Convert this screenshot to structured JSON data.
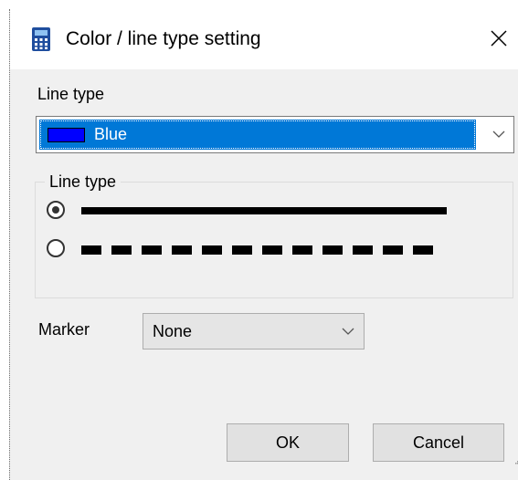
{
  "window": {
    "title": "Color / line type setting",
    "app_icon": "calculator-icon",
    "close_icon": "close-icon"
  },
  "color": {
    "label": "Line type",
    "selected_value": "Blue",
    "swatch_color": "#0000ff",
    "highlight_color": "#0078d7",
    "arrow_icon": "chevron-down-icon"
  },
  "line_type": {
    "group_label": "Line type",
    "options": [
      {
        "style": "solid",
        "selected": true
      },
      {
        "style": "dashed",
        "selected": false
      }
    ]
  },
  "marker": {
    "label": "Marker",
    "selected_value": "None",
    "arrow_icon": "chevron-down-icon"
  },
  "buttons": {
    "ok": "OK",
    "cancel": "Cancel"
  }
}
